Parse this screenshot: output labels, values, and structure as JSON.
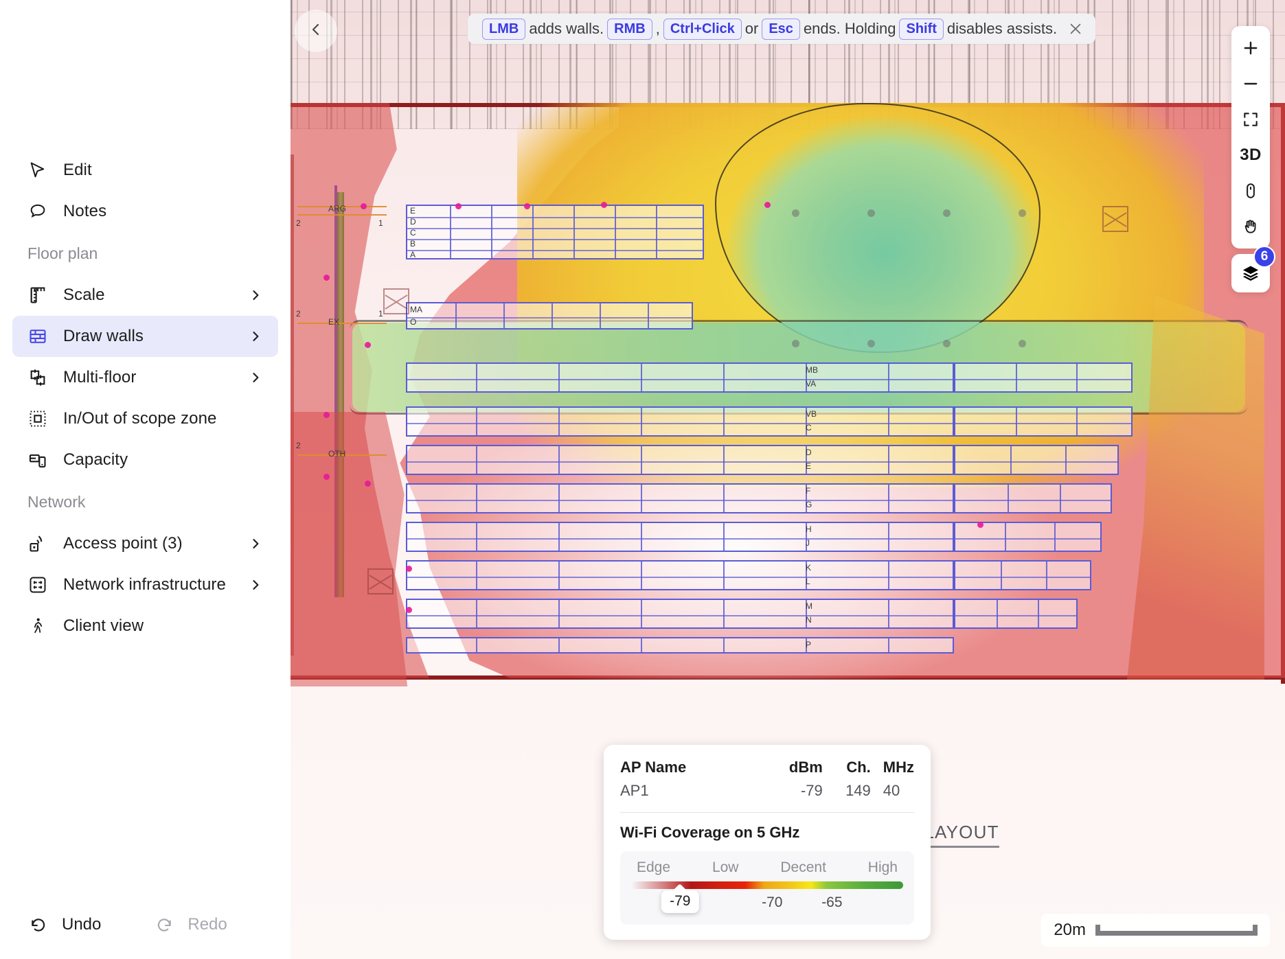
{
  "sidebar": {
    "top_items": [
      {
        "label": "Edit",
        "icon": "cursor-icon",
        "chevron": false
      },
      {
        "label": "Notes",
        "icon": "comment-icon",
        "chevron": false
      }
    ],
    "group_floorplan": {
      "title": "Floor plan",
      "items": [
        {
          "label": "Scale",
          "icon": "ruler-icon",
          "chevron": true,
          "active": false
        },
        {
          "label": "Draw walls",
          "icon": "brick-wall-icon",
          "chevron": true,
          "active": true
        },
        {
          "label": "Multi-floor",
          "icon": "multi-floor-icon",
          "chevron": true,
          "active": false
        },
        {
          "label": "In/Out of scope zone",
          "icon": "dashed-square-icon",
          "chevron": false,
          "active": false
        },
        {
          "label": "Capacity",
          "icon": "devices-icon",
          "chevron": false,
          "active": false
        }
      ]
    },
    "group_network": {
      "title": "Network",
      "items": [
        {
          "label": "Access point (3)",
          "icon": "access-point-icon",
          "chevron": true
        },
        {
          "label": "Network infrastructure",
          "icon": "network-infra-icon",
          "chevron": true
        },
        {
          "label": "Client view",
          "icon": "walking-person-icon",
          "chevron": false
        }
      ]
    },
    "footer": {
      "undo_label": "Undo",
      "undo_icon": "undo-arrow-icon",
      "redo_label": "Redo",
      "redo_icon": "redo-arrow-icon",
      "redo_disabled": true
    }
  },
  "hint": {
    "k1": "LMB",
    "t1": "adds walls.",
    "k2": "RMB",
    "t2": ",",
    "k3": "Ctrl+Click",
    "t3": "or",
    "k4": "Esc",
    "t4": "ends. Holding",
    "k5": "Shift",
    "t5": "disables assists.",
    "close_icon": "close-icon"
  },
  "tools": {
    "zoom_in": "+",
    "zoom_out": "−",
    "fit_label": "fit-to-screen-icon",
    "three_d": "3D",
    "mouse_label": "mouse-icon",
    "pan_label": "hand-icon",
    "layers_label": "layers-icon",
    "layers_badge": "6"
  },
  "legend": {
    "columns": [
      "AP Name",
      "dBm",
      "Ch.",
      "MHz"
    ],
    "rows": [
      {
        "name": "AP1",
        "dbm": "-79",
        "ch": "149",
        "mhz": "40"
      }
    ],
    "coverage_title": "Wi-Fi Coverage on 5 GHz",
    "bands": [
      "Edge",
      "Low",
      "Decent",
      "High"
    ],
    "ticks": [
      {
        "value": "-70",
        "pos_pct": 48
      },
      {
        "value": "-65",
        "pos_pct": 70
      }
    ],
    "marker_value": "-79",
    "marker_pos_pct": 18
  },
  "map": {
    "plan_title": "ND FLOOR LAYOUT",
    "scalebar_text": "20m",
    "collapse_icon": "chevron-left-icon",
    "row_labels": [
      "MB",
      "VA",
      "VB",
      "C",
      "D",
      "E",
      "F",
      "G",
      "H",
      "J",
      "K",
      "L",
      "M",
      "N",
      "P"
    ],
    "small_labels": [
      "ARG",
      "EX",
      "OTH"
    ],
    "colors": {
      "accent": "#3b41e8",
      "active_bg": "#e8e9fb",
      "high": "#3d9a38",
      "decent": "#f2c41c",
      "low": "#e8230a",
      "edge": "#b21717",
      "wall": "#8e1d1d"
    }
  }
}
